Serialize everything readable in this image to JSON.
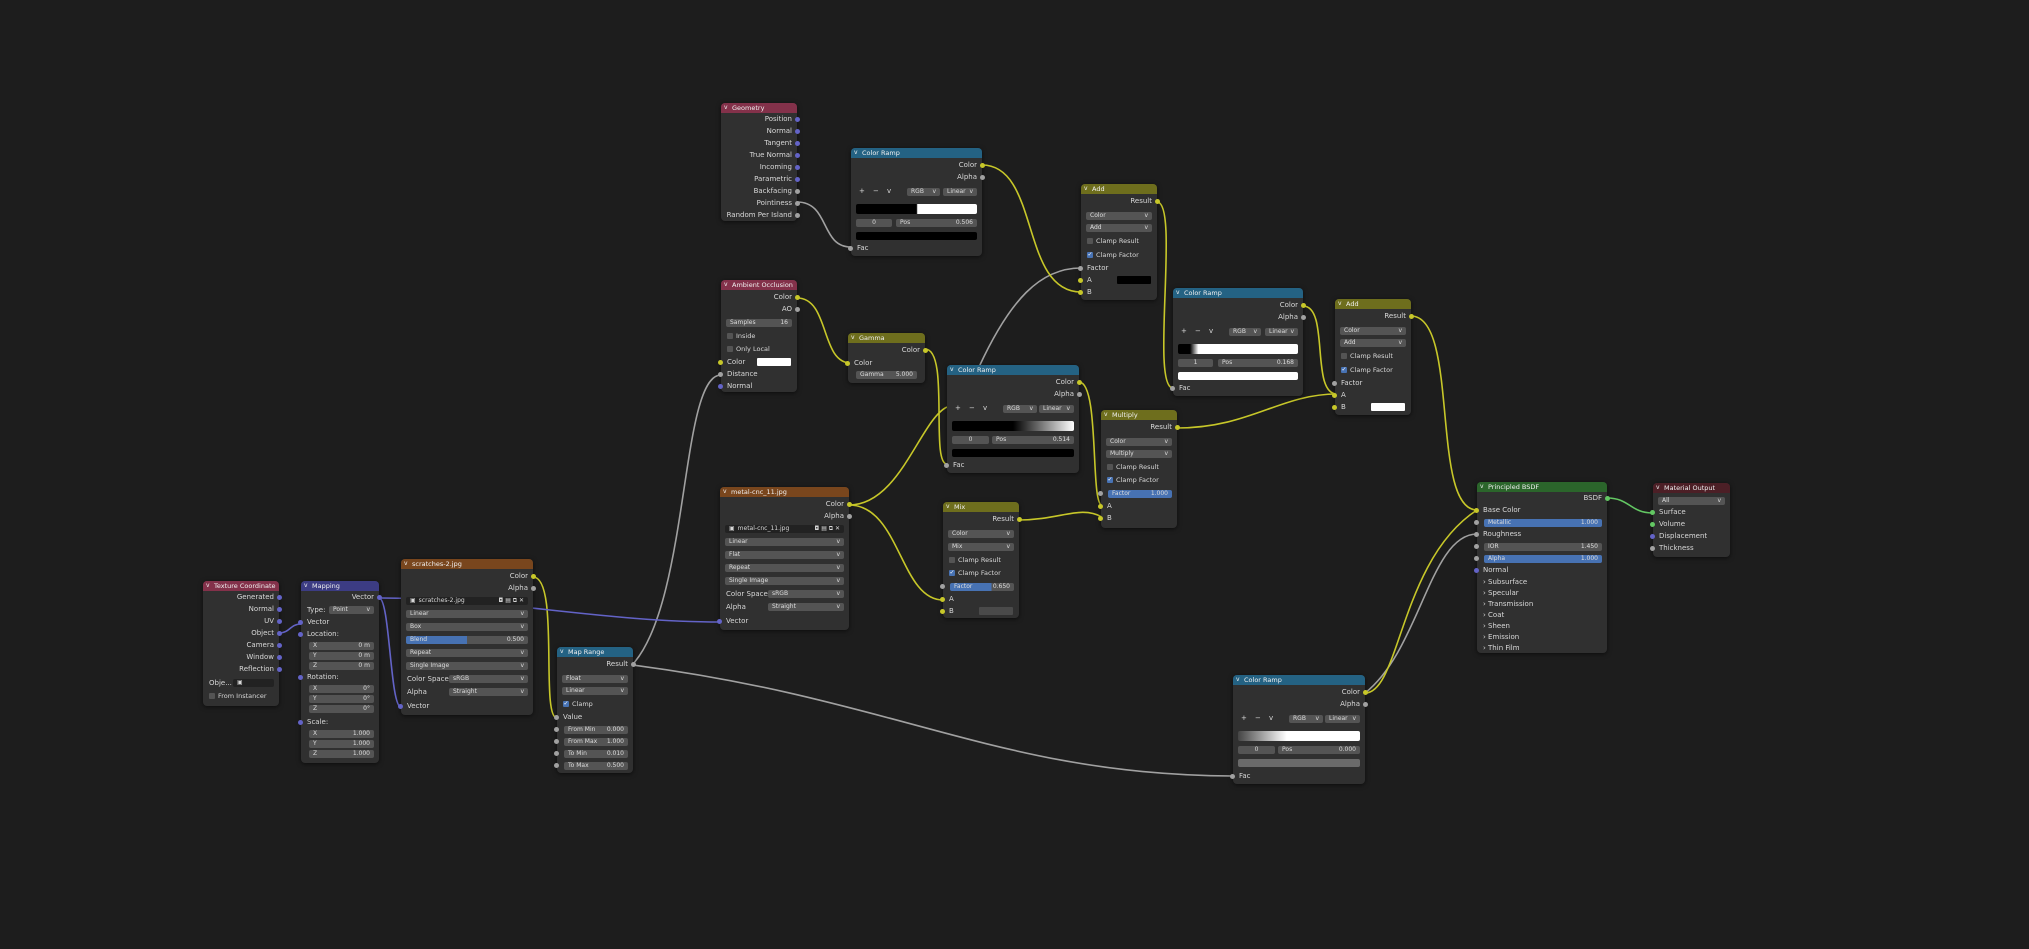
{
  "nodes": {
    "geometry": {
      "title": "Geometry",
      "outputs": [
        "Position",
        "Normal",
        "Tangent",
        "True Normal",
        "Incoming",
        "Parametric",
        "Backfacing",
        "Pointiness",
        "Random Per Island"
      ]
    },
    "color_ramp_1": {
      "title": "Color Ramp",
      "out_color": "Color",
      "out_alpha": "Alpha",
      "mode": "RGB",
      "interp": "Linear",
      "index": "0",
      "pos_label": "Pos",
      "pos_value": "0.506",
      "in_fac": "Fac"
    },
    "add_1": {
      "title": "Add",
      "out": "Result",
      "type": "Color",
      "op": "Add",
      "clamp_result": "Clamp Result",
      "clamp_factor": "Clamp Factor",
      "in_factor": "Factor",
      "in_a": "A",
      "in_b": "B"
    },
    "color_ramp_2": {
      "title": "Color Ramp",
      "out_color": "Color",
      "out_alpha": "Alpha",
      "mode": "RGB",
      "interp": "Linear",
      "index": "1",
      "pos_label": "Pos",
      "pos_value": "0.168",
      "in_fac": "Fac"
    },
    "add_2": {
      "title": "Add",
      "out": "Result",
      "type": "Color",
      "op": "Add",
      "clamp_result": "Clamp Result",
      "clamp_factor": "Clamp Factor",
      "in_factor": "Factor",
      "in_a": "A",
      "in_b": "B"
    },
    "ambient_occlusion": {
      "title": "Ambient Occlusion",
      "out_color": "Color",
      "out_ao": "AO",
      "samples_label": "Samples",
      "samples_value": "16",
      "inside": "Inside",
      "only_local": "Only Local",
      "in_color": "Color",
      "in_distance": "Distance",
      "in_normal": "Normal"
    },
    "gamma": {
      "title": "Gamma",
      "out": "Color",
      "in_color": "Color",
      "gamma_label": "Gamma",
      "gamma_value": "5.000"
    },
    "color_ramp_3": {
      "title": "Color Ramp",
      "out_color": "Color",
      "out_alpha": "Alpha",
      "mode": "RGB",
      "interp": "Linear",
      "index": "0",
      "pos_label": "Pos",
      "pos_value": "0.514",
      "in_fac": "Fac"
    },
    "multiply": {
      "title": "Multiply",
      "out": "Result",
      "type": "Color",
      "op": "Multiply",
      "clamp_result": "Clamp Result",
      "clamp_factor": "Clamp Factor",
      "factor_label": "Factor",
      "factor_value": "1.000",
      "in_a": "A",
      "in_b": "B"
    },
    "metal_image": {
      "title": "metal-cnc_11.jpg",
      "out_color": "Color",
      "out_alpha": "Alpha",
      "filename": "metal-cnc_11.jpg",
      "interp": "Linear",
      "proj": "Flat",
      "ext": "Repeat",
      "source": "Single Image",
      "cs_label": "Color Space",
      "cs_value": "sRGB",
      "alpha_label": "Alpha",
      "alpha_value": "Straight",
      "in_vector": "Vector"
    },
    "mix": {
      "title": "Mix",
      "out": "Result",
      "type": "Color",
      "op": "Mix",
      "clamp_result": "Clamp Result",
      "clamp_factor": "Clamp Factor",
      "factor_label": "Factor",
      "factor_value": "0.650",
      "in_a": "A",
      "in_b": "B"
    },
    "texture_coordinate": {
      "title": "Texture Coordinate",
      "outputs": [
        "Generated",
        "Normal",
        "UV",
        "Object",
        "Camera",
        "Window",
        "Reflection"
      ],
      "object_label": "Obje...",
      "from_instancer": "From Instancer"
    },
    "mapping": {
      "title": "Mapping",
      "out_vector": "Vector",
      "type_label": "Type:",
      "type_value": "Point",
      "in_vector": "Vector",
      "location": "Location:",
      "rotation": "Rotation:",
      "scale": "Scale:",
      "loc": [
        [
          "X",
          "0 m"
        ],
        [
          "Y",
          "0 m"
        ],
        [
          "Z",
          "0 m"
        ]
      ],
      "rot": [
        [
          "X",
          "0°"
        ],
        [
          "Y",
          "0°"
        ],
        [
          "Z",
          "0°"
        ]
      ],
      "scl": [
        [
          "X",
          "1.000"
        ],
        [
          "Y",
          "1.000"
        ],
        [
          "Z",
          "1.000"
        ]
      ],
      "in_vector2": "Vector"
    },
    "scratches_image": {
      "title": "scratches-2.jpg",
      "out_color": "Color",
      "out_alpha": "Alpha",
      "filename": "scratches-2.jpg",
      "interp": "Linear",
      "proj": "Box",
      "blend_label": "Blend",
      "blend_value": "0.500",
      "ext": "Repeat",
      "source": "Single Image",
      "cs_label": "Color Space",
      "cs_value": "sRGB",
      "alpha_label": "Alpha",
      "alpha_value": "Straight",
      "in_vector": "Vector"
    },
    "map_range": {
      "title": "Map Range",
      "out": "Result",
      "dtype": "Float",
      "interp": "Linear",
      "clamp": "Clamp",
      "in_value": "Value",
      "fields": [
        [
          "From Min",
          "0.000"
        ],
        [
          "From Max",
          "1.000"
        ],
        [
          "To Min",
          "0.010"
        ],
        [
          "To Max",
          "0.500"
        ]
      ]
    },
    "principled": {
      "title": "Principled BSDF",
      "out": "BSDF",
      "base_color": "Base Color",
      "metallic_label": "Metallic",
      "metallic_value": "1.000",
      "roughness": "Roughness",
      "ior_label": "IOR",
      "ior_value": "1.450",
      "alpha_label": "Alpha",
      "alpha_value": "1.000",
      "normal": "Normal",
      "panels": [
        "Subsurface",
        "Specular",
        "Transmission",
        "Coat",
        "Sheen",
        "Emission",
        "Thin Film"
      ]
    },
    "material_output": {
      "title": "Material Output",
      "target": "All",
      "inputs": [
        "Surface",
        "Volume",
        "Displacement",
        "Thickness"
      ]
    },
    "color_ramp_4": {
      "title": "Color Ramp",
      "out_color": "Color",
      "out_alpha": "Alpha",
      "mode": "RGB",
      "interp": "Linear",
      "index": "0",
      "pos_label": "Pos",
      "pos_value": "0.000",
      "in_fac": "Fac"
    }
  },
  "colors": {
    "bg": "#1d1d1d",
    "node": "#303030",
    "hdr_input": "#83314a",
    "hdr_converter": "#246283",
    "hdr_color": "#6e6e1d",
    "hdr_texture": "#79461d",
    "hdr_vector": "#3c3c83",
    "hdr_shader": "#2b652b",
    "hdr_output": "#4c1f26",
    "wire_yellow": "#c7c729",
    "wire_gray": "#a1a1a1",
    "wire_purple": "#6363c7",
    "wire_green": "#63c763"
  }
}
